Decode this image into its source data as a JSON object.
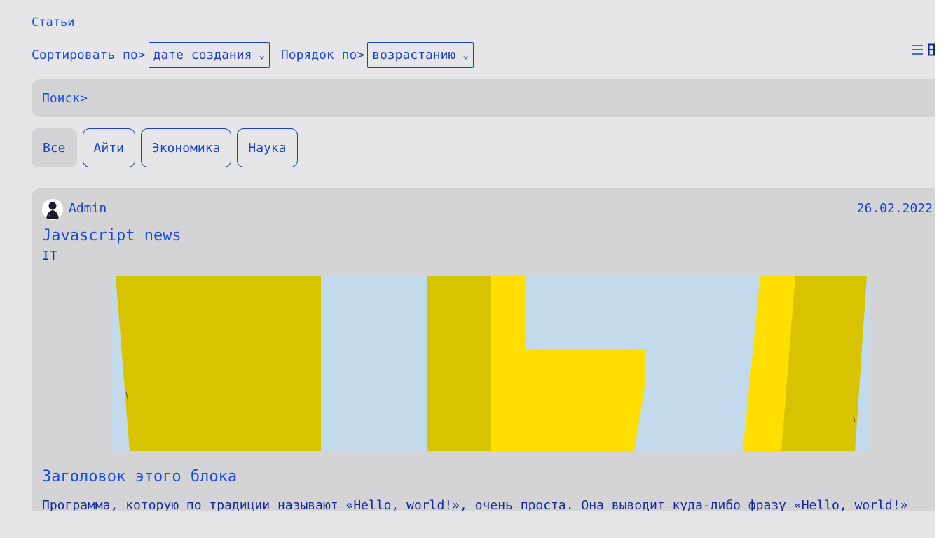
{
  "nav": {
    "title": "Статьи"
  },
  "sort": {
    "by_label": "Сортировать по>",
    "by_value": "дате создания",
    "order_label": "Порядок по>",
    "order_value": "возрастанию"
  },
  "view_toggle": {
    "list_icon": "list-icon",
    "grid_icon": "grid-icon"
  },
  "search": {
    "label": "Поиск>"
  },
  "categories": [
    "Все",
    "Айти",
    "Экономика",
    "Наука"
  ],
  "article": {
    "author": "Admin",
    "date": "26.02.2022",
    "title": "Javascript news",
    "tag": "IT",
    "block_title": "Заголовок этого блока",
    "excerpt": "Программа, которую по традиции называют «Hello, world!», очень проста. Она выводит куда-либо фразу «Hello, world!»"
  },
  "colors": {
    "accent": "#1a3fd6",
    "panel": "#d4d4d7",
    "background": "#e6e6e9",
    "image_yellow": "#d8c300",
    "image_bright": "#ffde00",
    "image_blue": "#c3daed"
  }
}
